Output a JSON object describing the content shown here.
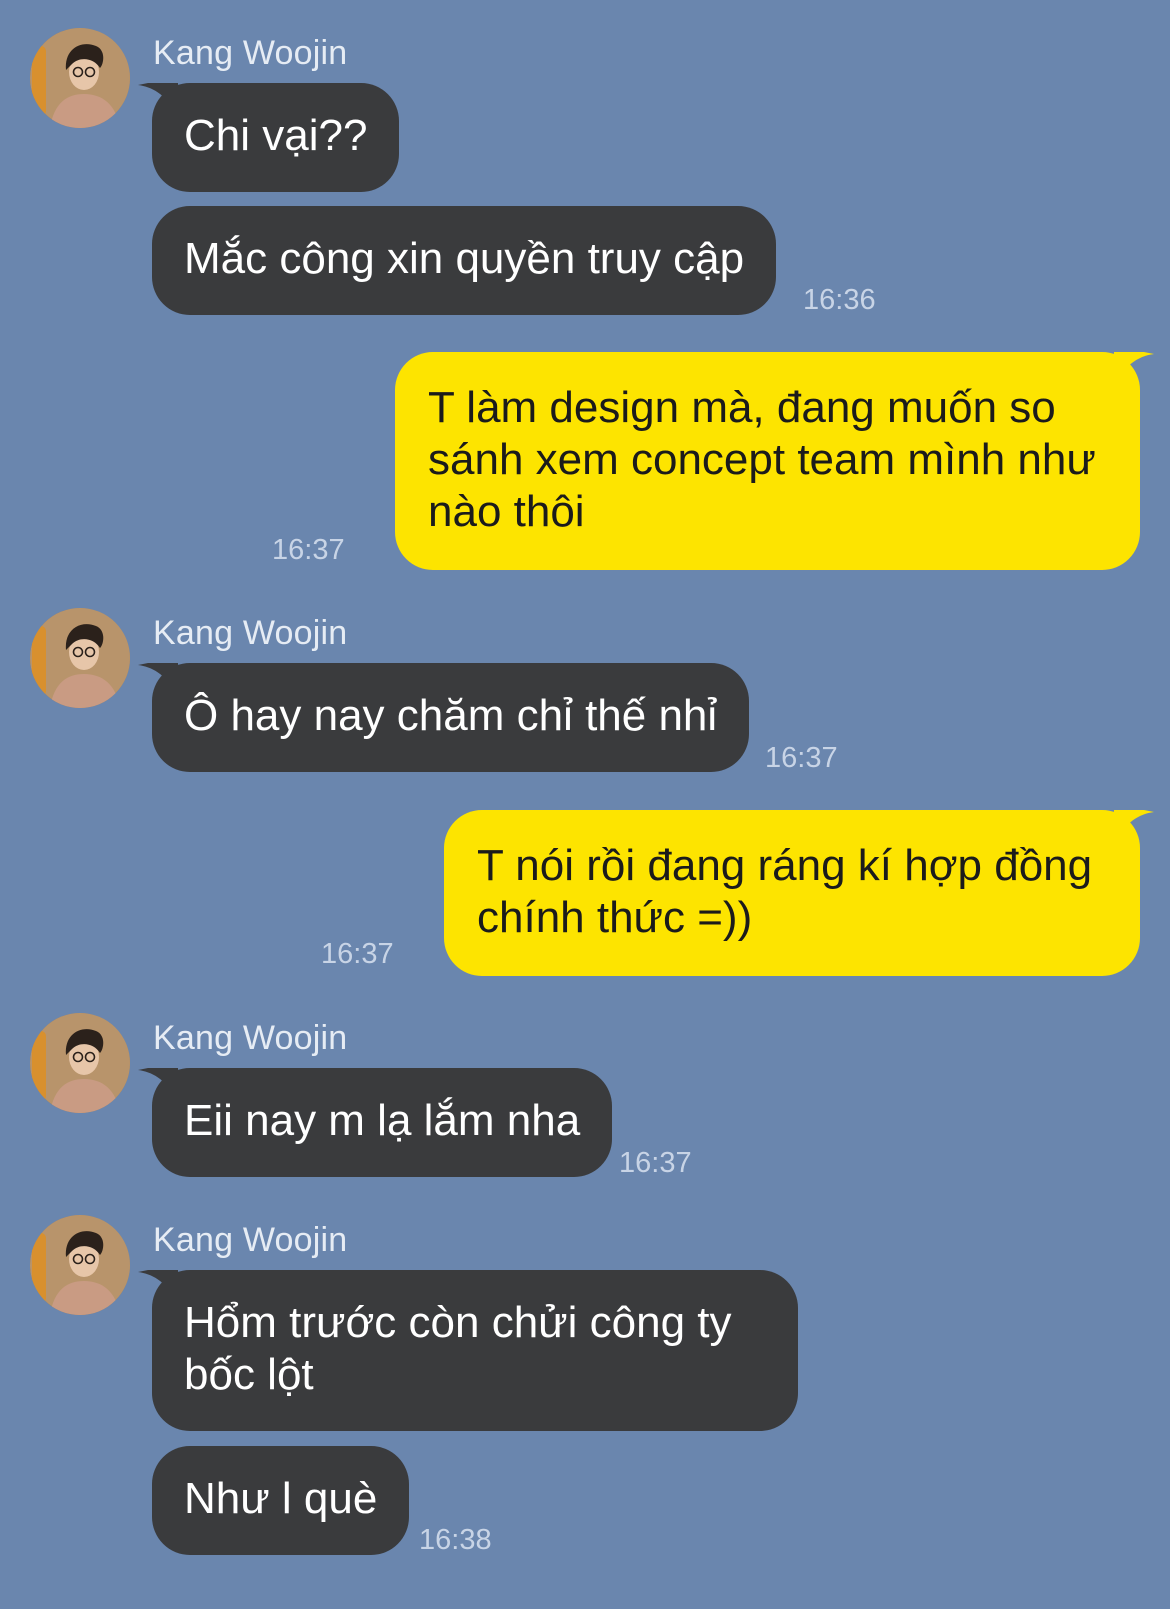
{
  "chat": {
    "contact_name": "Kang Woojin",
    "messages": [
      {
        "from": "contact",
        "sender": "Kang Woojin",
        "text": "Chi vại??"
      },
      {
        "from": "contact",
        "text": "Mắc công xin quyền truy cập",
        "time": "16:36"
      },
      {
        "from": "me",
        "text": "T làm design mà, đang muốn so sánh xem concept team mình như nào thôi",
        "time": "16:37"
      },
      {
        "from": "contact",
        "sender": "Kang Woojin",
        "text": "Ô hay nay chăm chỉ thế nhỉ",
        "time": "16:37"
      },
      {
        "from": "me",
        "text": "T nói rồi đang ráng kí hợp đồng chính thức =))",
        "time": "16:37"
      },
      {
        "from": "contact",
        "sender": "Kang Woojin",
        "text": "Eii nay m lạ lắm nha",
        "time": "16:37"
      },
      {
        "from": "contact",
        "sender": "Kang Woojin",
        "text": "Hổm trước còn chửi công ty bốc lột"
      },
      {
        "from": "contact",
        "text": "Như l què",
        "time": "16:38"
      }
    ]
  },
  "colors": {
    "background": "#6a86ae",
    "incoming_bubble": "#3a3b3d",
    "outgoing_bubble": "#fde400"
  },
  "icons": {
    "avatar": "profile-photo"
  }
}
